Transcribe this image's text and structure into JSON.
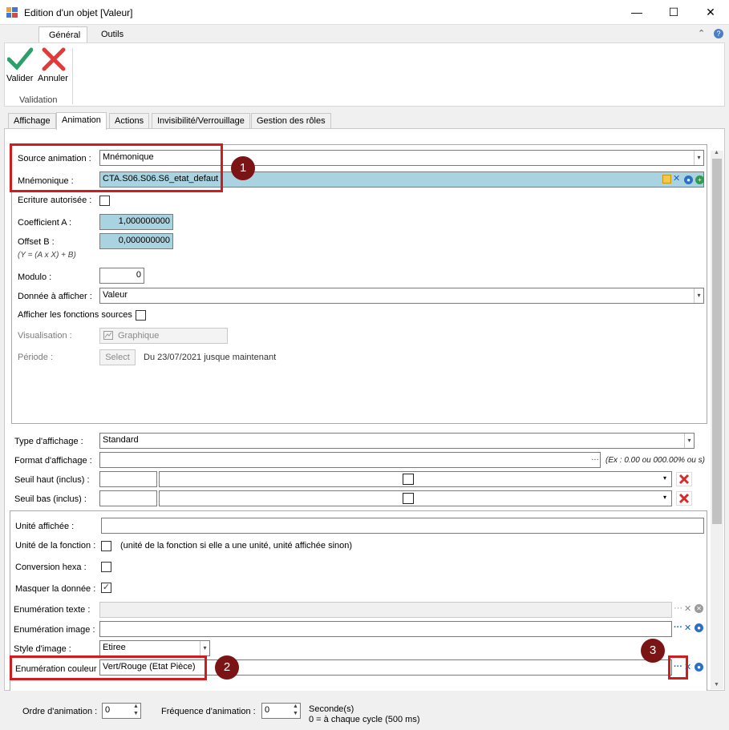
{
  "window": {
    "title": "Edition d'un objet [Valeur]",
    "min_glyph": "—",
    "max_glyph": "☐",
    "close_glyph": "✕"
  },
  "ribbon": {
    "tabs": [
      "Général",
      "Outils"
    ],
    "collapse_glyph": "⌃",
    "help_glyph": "?",
    "validate_label": "Valider",
    "cancel_label": "Annuler",
    "group_label": "Validation"
  },
  "tabs": [
    "Affichage",
    "Animation",
    "Actions",
    "Invisibilité/Verrouillage",
    "Gestion des rôles"
  ],
  "animation": {
    "source_label": "Source animation :",
    "source_value": "Mnémonique",
    "mnemonic_label": "Mnémonique :",
    "mnemonic_value": "CTA.S06.S06.S6_etat_defaut",
    "write_label": "Ecriture autorisée :",
    "coef_a_label": "Coefficient A :",
    "coef_a_value": "1,000000000",
    "offset_b_label": "Offset B :",
    "offset_b_value": "0,000000000",
    "formula": "(Y = (A x X) + B)",
    "modulo_label": "Modulo :",
    "modulo_value": "0",
    "data_label": "Donnée à afficher :",
    "data_value": "Valeur",
    "show_sources_label": "Afficher les fonctions sources :",
    "visual_label": "Visualisation :",
    "visual_value": "Graphique",
    "period_label": "Période :",
    "period_button": "Select",
    "period_text": "Du 23/07/2021 jusque maintenant"
  },
  "display": {
    "type_label": "Type d'affichage :",
    "type_value": "Standard",
    "format_label": "Format d'affichage :",
    "format_value": "",
    "format_hint": "(Ex : 0.00 ou 000.00% ou s)",
    "high_label": "Seuil haut (inclus) :",
    "low_label": "Seuil bas (inclus) :"
  },
  "unit": {
    "shown_label": "Unité affichée :",
    "function_label": "Unité de la fonction :",
    "function_hint": "(unité de la fonction si elle a une unité, unité affichée sinon)",
    "hex_label": "Conversion hexa :",
    "mask_label": "Masquer la donnée :",
    "enum_text_label": "Enumération texte :",
    "enum_image_label": "Enumération image :",
    "image_style_label": "Style d'image :",
    "image_style_value": "Etiree",
    "enum_color_label": "Enumération couleur :",
    "enum_color_value": "Vert/Rouge (Etat Pièce)"
  },
  "footer": {
    "order_label": "Ordre d'animation :",
    "order_value": "0",
    "freq_label": "Fréquence d'animation :",
    "freq_value": "0",
    "unit_label": "Seconde(s)",
    "hint": "0 = à chaque cycle (500 ms)"
  },
  "callouts": [
    "1",
    "2",
    "3"
  ],
  "colors": {
    "highlight": "#d01c1c",
    "badge": "#7b1414",
    "field_blue": "#a9d3e0",
    "check_green": "#2e9e6a",
    "cancel_red": "#e03a3a"
  }
}
